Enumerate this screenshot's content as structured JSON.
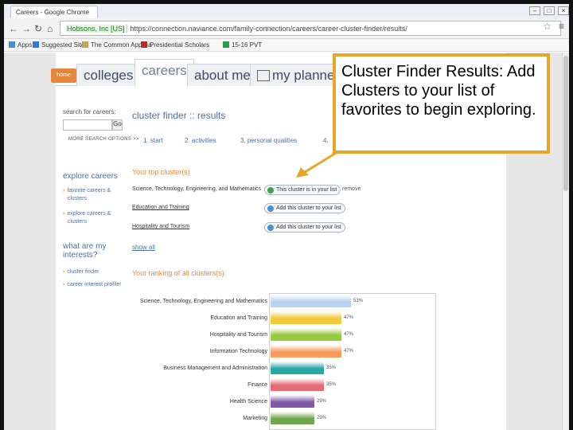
{
  "browser": {
    "tab_title": "Careers - Google Chrome",
    "ev_cert": "Hobsons, Inc [US]",
    "url": "https://connection.naviance.com/family-connection/careers/career-cluster-finder/results/",
    "bookmarks": [
      {
        "label": "Apps",
        "color": "#4a8fd0"
      },
      {
        "label": "Suggested Sites",
        "color": "#2e7bd6"
      },
      {
        "label": "The Common Applica",
        "color": "#c8a15a"
      },
      {
        "label": "Presidential Scholars",
        "color": "#b03030"
      },
      {
        "label": "15-16 PVT",
        "color": "#2a9b4e"
      }
    ]
  },
  "nav": {
    "home": "home",
    "tabs": [
      "colleges",
      "careers",
      "about me",
      "my planner"
    ]
  },
  "search": {
    "label": "search for careers:",
    "go": "Go",
    "more": "MORE SEARCH OPTIONS >>"
  },
  "page_title": "cluster finder :: results",
  "steps": [
    "1. start",
    "2. activities",
    "3. personal qualities",
    "4."
  ],
  "sidebar": {
    "explore_head": "explore careers",
    "explore_links": [
      {
        "line1": "favorite careers &",
        "line2": "clusters"
      },
      {
        "line1": "explore careers &",
        "line2": "clusters"
      }
    ],
    "interests_head": [
      "what are my",
      "interests?"
    ],
    "interest_links": [
      "cluster finder",
      "career interest profiler"
    ]
  },
  "top_clusters": {
    "head": "Your top cluster(s)",
    "items": [
      {
        "name": "Science, Technology, Engineering, and Mathematics",
        "action": "This cluster is in your list",
        "added": true,
        "remove": "remove"
      },
      {
        "name": "Education and Training",
        "action": "Add this cluster to your list",
        "added": false
      },
      {
        "name": "Hospitality and Tourism",
        "action": "Add this cluster to your list",
        "added": false
      }
    ],
    "show_all": "show all"
  },
  "ranking": {
    "head": "Your ranking of all clusters(s)",
    "rows": [
      {
        "name": "Science, Technology, Engineering and Mathematics",
        "pct": "53%",
        "value": 53,
        "color": "#b9d4f2"
      },
      {
        "name": "Education and Training",
        "pct": "47%",
        "value": 47,
        "color": "#f3c939"
      },
      {
        "name": "Hospitality and Tourism",
        "pct": "47%",
        "value": 47,
        "color": "#96c93d"
      },
      {
        "name": "Information Technology",
        "pct": "47%",
        "value": 47,
        "color": "#f79a5e"
      },
      {
        "name": "Business Management and Administration",
        "pct": "35%",
        "value": 35,
        "color": "#2aa6a6"
      },
      {
        "name": "Finance",
        "pct": "35%",
        "value": 35,
        "color": "#e86a74"
      },
      {
        "name": "Health Science",
        "pct": "29%",
        "value": 29,
        "color": "#7e5aa8"
      },
      {
        "name": "Marketing",
        "pct": "29%",
        "value": 29,
        "color": "#6ea84a"
      }
    ]
  },
  "callout": {
    "text": "Cluster Finder Results: Add Clusters to your list of favorites to begin exploring."
  }
}
